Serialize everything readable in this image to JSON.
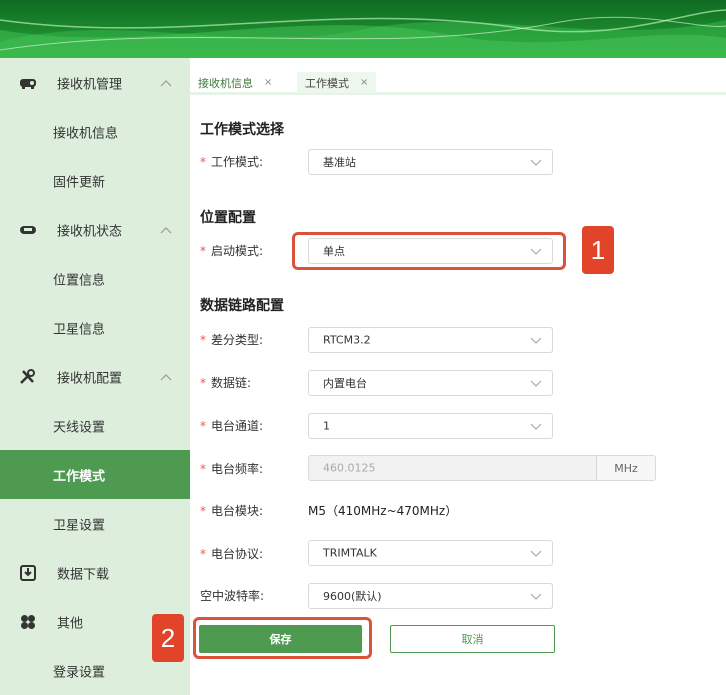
{
  "sidebar": {
    "groups": [
      {
        "label": "接收机管理",
        "icon": "router-icon",
        "items": [
          "接收机信息",
          "固件更新"
        ]
      },
      {
        "label": "接收机状态",
        "icon": "headset-icon",
        "items": [
          "位置信息",
          "卫星信息"
        ]
      },
      {
        "label": "接收机配置",
        "icon": "tools-icon",
        "items": [
          "天线设置",
          "工作模式",
          "卫星设置"
        ]
      },
      {
        "label": "数据下载",
        "icon": "download-icon",
        "items": []
      },
      {
        "label": "其他",
        "icon": "clover-icon",
        "items": [
          "登录设置"
        ]
      }
    ],
    "active_item": "工作模式"
  },
  "tabs": [
    {
      "label": "接收机信息",
      "close": "×"
    },
    {
      "label": "工作模式",
      "close": "×"
    }
  ],
  "form": {
    "section_work_mode": "工作模式选择",
    "work_mode": {
      "label": "工作模式:",
      "value": "基准站"
    },
    "section_position": "位置配置",
    "start_mode": {
      "label": "启动模式:",
      "value": "单点"
    },
    "section_datalink": "数据链路配置",
    "diff_type": {
      "label": "差分类型:",
      "value": "RTCM3.2"
    },
    "datalink": {
      "label": "数据链:",
      "value": "内置电台"
    },
    "radio_channel": {
      "label": "电台通道:",
      "value": "1"
    },
    "radio_freq": {
      "label": "电台频率:",
      "value": "460.0125",
      "unit": "MHz"
    },
    "radio_module": {
      "label": "电台模块:",
      "value": "M5（410MHz~470MHz）"
    },
    "radio_protocol": {
      "label": "电台协议:",
      "value": "TRIMTALK"
    },
    "air_baud": {
      "label": "空中波特率:",
      "value": "9600(默认)"
    },
    "required_mark": "*"
  },
  "buttons": {
    "save": "保存",
    "cancel": "取消"
  },
  "annotations": {
    "badge1": "1",
    "badge2": "2"
  },
  "colors": {
    "accent": "#4e9a50",
    "sidebar_bg": "#ddeedd",
    "highlight": "#d8533a",
    "badge": "#e2442a"
  }
}
